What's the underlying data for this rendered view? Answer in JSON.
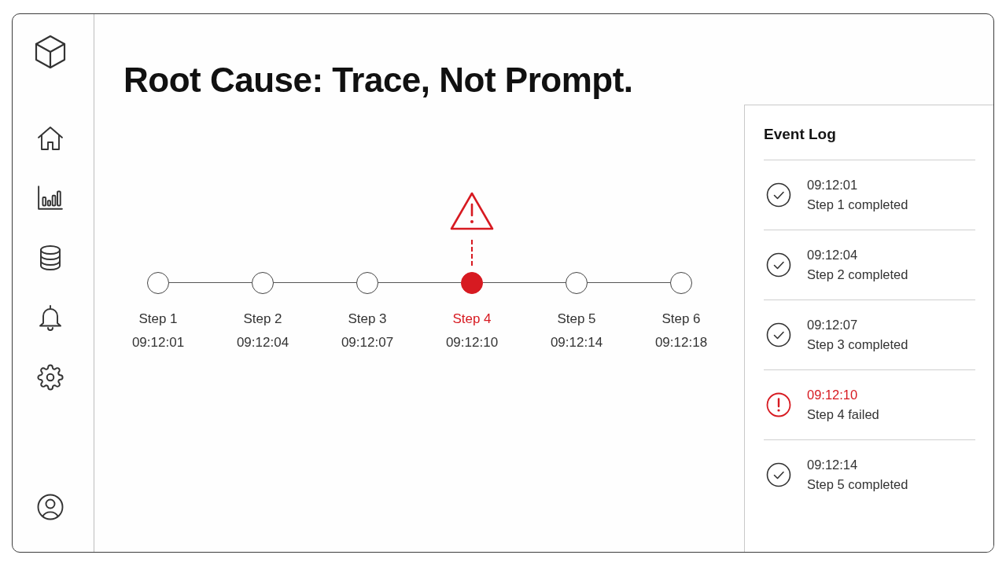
{
  "title": "Root Cause: Trace, Not Prompt.",
  "timeline": {
    "steps": [
      {
        "label": "Step 1",
        "time": "09:12:01",
        "failed": false
      },
      {
        "label": "Step 2",
        "time": "09:12:04",
        "failed": false
      },
      {
        "label": "Step 3",
        "time": "09:12:07",
        "failed": false
      },
      {
        "label": "Step 4",
        "time": "09:12:10",
        "failed": true
      },
      {
        "label": "Step 5",
        "time": "09:12:14",
        "failed": false
      },
      {
        "label": "Step 6",
        "time": "09:12:18",
        "failed": false
      }
    ]
  },
  "event_log": {
    "title": "Event Log",
    "entries": [
      {
        "time": "09:12:01",
        "message": "Step 1 completed",
        "failed": false
      },
      {
        "time": "09:12:04",
        "message": "Step 2 completed",
        "failed": false
      },
      {
        "time": "09:12:07",
        "message": "Step 3 completed",
        "failed": false
      },
      {
        "time": "09:12:10",
        "message": "Step 4 failed",
        "failed": true
      },
      {
        "time": "09:12:14",
        "message": "Step 5 completed",
        "failed": false
      }
    ]
  }
}
